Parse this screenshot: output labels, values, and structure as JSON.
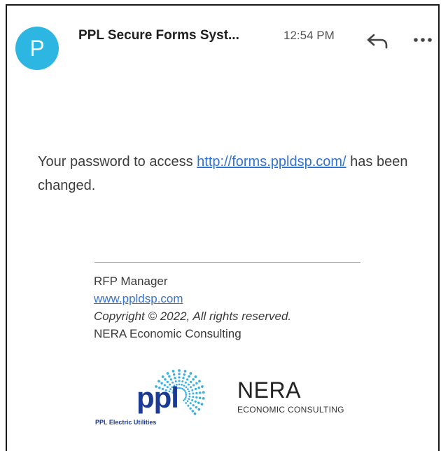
{
  "header": {
    "avatar_letter": "P",
    "sender": "PPL Secure Forms Syst...",
    "time": "12:54 PM",
    "reply_icon": "reply-arrow-icon",
    "more_icon": "more-horizontal-icon"
  },
  "message": {
    "text_before": "Your password to access ",
    "link": "http://forms.ppldsp.com/",
    "text_after": " has been changed."
  },
  "signature": {
    "line1": "RFP Manager",
    "link": "www.ppldsp.com",
    "copyright": "Copyright © 2022, All rights reserved.",
    "company": "NERA Economic Consulting"
  },
  "logos": {
    "ppl_word": "ppl",
    "ppl_tagline": "PPL Electric Utilities",
    "nera_word": "NERA",
    "nera_tagline": "ECONOMIC CONSULTING"
  },
  "colors": {
    "avatar": "#2eb6e2",
    "link": "#3373d0",
    "ppl_blue": "#1a3a94",
    "ppl_burst": "#3ab0e0"
  }
}
